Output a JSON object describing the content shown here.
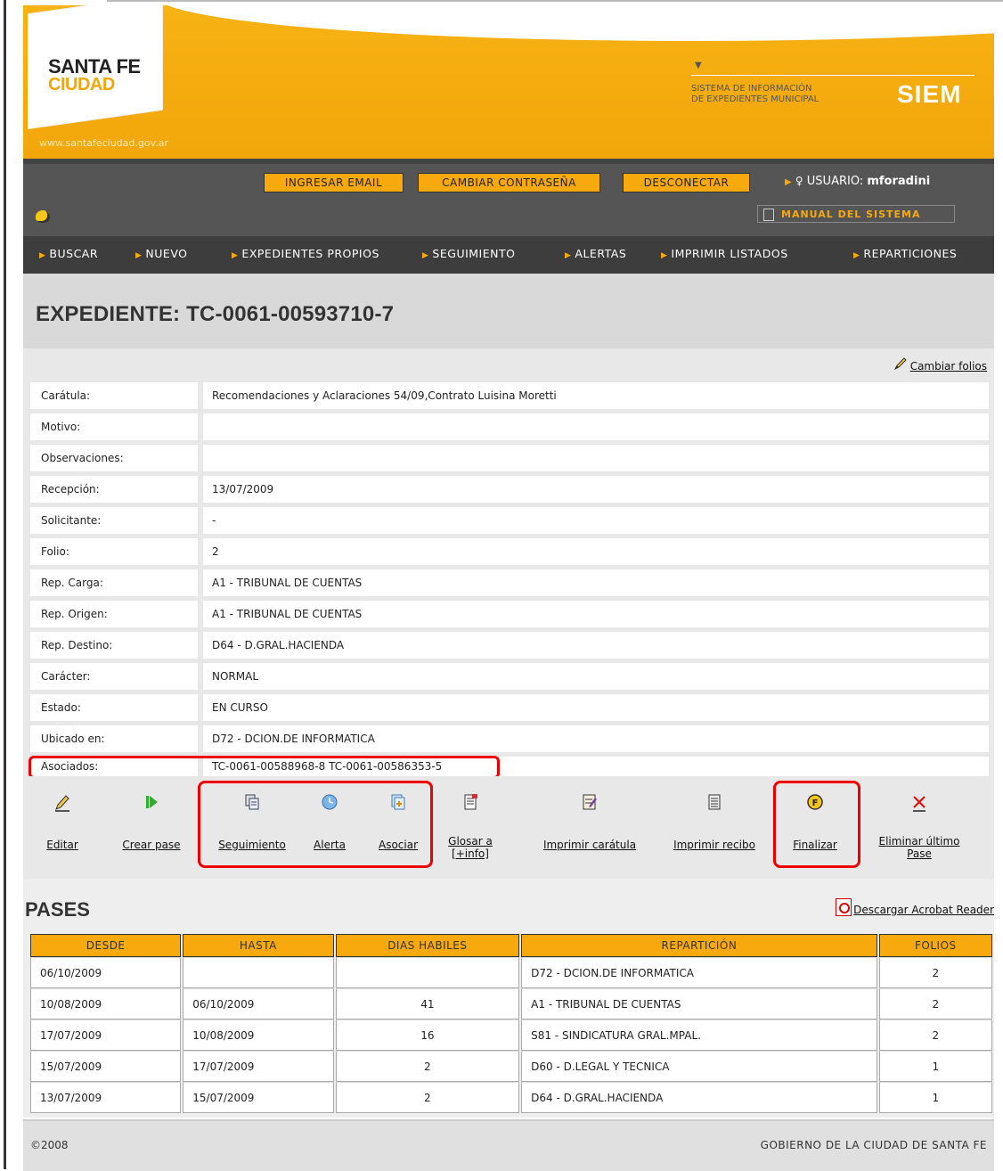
{
  "header": {
    "logo_line1": "SANTA FE",
    "logo_line2": "CIUDAD",
    "site_url": "www.santafeciudad.gov.ar",
    "system_desc_line1": "SISTEMA DE INFORMACIÓN",
    "system_desc_line2": "DE EXPEDIENTES MUNICIPAL",
    "system_name": "SIEM",
    "accent_color": "#f7a90e"
  },
  "toolbar": {
    "ingresar_email": "INGRESAR EMAIL",
    "cambiar_contrasena": "CAMBIAR CONTRASEÑA",
    "desconectar": "DESCONECTAR",
    "user_label": "USUARIO:",
    "user_name": "mforadini",
    "manual": "MANUAL DEL SISTEMA"
  },
  "nav": {
    "items": [
      "BUSCAR",
      "NUEVO",
      "EXPEDIENTES PROPIOS",
      "SEGUIMIENTO",
      "ALERTAS",
      "IMPRIMIR LISTADOS",
      "REPARTICIONES"
    ]
  },
  "page": {
    "title": "EXPEDIENTE: TC-0061-00593710-7",
    "cambiar_folios": "Cambiar folios"
  },
  "details": [
    {
      "label": "Carátula:",
      "value": "Recomendaciones y Aclaraciones 54/09,Contrato Luisina Moretti"
    },
    {
      "label": "Motivo:",
      "value": ""
    },
    {
      "label": "Observaciones:",
      "value": ""
    },
    {
      "label": "Recepción:",
      "value": "13/07/2009"
    },
    {
      "label": "Solicitante:",
      "value": "-"
    },
    {
      "label": "Folio:",
      "value": "2"
    },
    {
      "label": "Rep. Carga:",
      "value": "A1 - TRIBUNAL DE CUENTAS"
    },
    {
      "label": "Rep. Origen:",
      "value": "A1 - TRIBUNAL DE CUENTAS"
    },
    {
      "label": "Rep. Destino:",
      "value": "D64 - D.GRAL.HACIENDA"
    },
    {
      "label": "Carácter:",
      "value": "NORMAL"
    },
    {
      "label": "Estado:",
      "value": "EN CURSO"
    },
    {
      "label": "Ubicado en:",
      "value": "D72 - DCION.DE INFORMATICA"
    },
    {
      "label": "Asociados:",
      "value": "TC-0061-00588968-8 TC-0061-00586353-5"
    }
  ],
  "actions": {
    "editar": "Editar",
    "crear_pase": "Crear pase",
    "seguimiento": "Seguimiento",
    "alerta": "Alerta",
    "asociar": "Asociar",
    "glosar_line1": "Glosar a",
    "glosar_line2": "[+info]",
    "imprimir_caratula": "Imprimir carátula",
    "imprimir_recibo": "Imprimir recibo",
    "finalizar": "Finalizar",
    "eliminar_line1": "Eliminar último",
    "eliminar_line2": "Pase"
  },
  "pases": {
    "title": "PASES",
    "acrobat": "Descargar Acrobat Reader",
    "headers": [
      "DESDE",
      "HASTA",
      "DIAS HABILES",
      "REPARTICIÓN",
      "FOLIOS"
    ],
    "rows": [
      [
        "06/10/2009",
        "",
        "",
        "D72 - DCION.DE INFORMATICA",
        "2"
      ],
      [
        "10/08/2009",
        "06/10/2009",
        "41",
        "A1 - TRIBUNAL DE CUENTAS",
        "2"
      ],
      [
        "17/07/2009",
        "10/08/2009",
        "16",
        "S81 - SINDICATURA GRAL.MPAL.",
        "2"
      ],
      [
        "15/07/2009",
        "17/07/2009",
        "2",
        "D60 - D.LEGAL Y TECNICA",
        "1"
      ],
      [
        "13/07/2009",
        "15/07/2009",
        "2",
        "D64 - D.GRAL.HACIENDA",
        "1"
      ]
    ]
  },
  "footer": {
    "copyright": "©2008",
    "gobierno": "GOBIERNO DE LA CIUDAD DE SANTA FE"
  }
}
